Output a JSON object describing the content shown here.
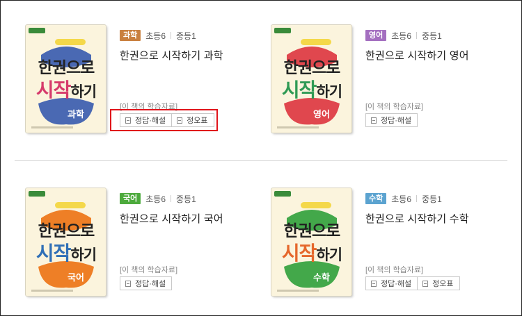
{
  "materials_label": "[이 책의 학습자료]",
  "books": [
    {
      "subject_tag": "과학",
      "tag_color": "#c9803f",
      "grade_elem": "초등6",
      "grade_mid": "중등1",
      "title": "한권으로 시작하기 과학",
      "cover": {
        "line1": "한권으로",
        "line2_a": "시작",
        "line2_b": "하기",
        "subject": "과학",
        "blob_color": "#4a69b3",
        "accent_color": "#d63a6b"
      },
      "buttons": [
        {
          "label": "정답·해설",
          "icon": "document-icon"
        },
        {
          "label": "정오표",
          "icon": "clipboard-icon"
        }
      ]
    },
    {
      "subject_tag": "영어",
      "tag_color": "#a46fc0",
      "grade_elem": "초등6",
      "grade_mid": "중등1",
      "title": "한권으로 시작하기 영어",
      "cover": {
        "line1": "한권으로",
        "line2_a": "시작",
        "line2_b": "하기",
        "subject": "영어",
        "blob_color": "#e0474e",
        "accent_color": "#2f9a54"
      },
      "buttons": [
        {
          "label": "정답·해설",
          "icon": "document-icon"
        }
      ]
    },
    {
      "subject_tag": "국어",
      "tag_color": "#4caa3c",
      "grade_elem": "초등6",
      "grade_mid": "중등1",
      "title": "한권으로 시작하기 국어",
      "cover": {
        "line1": "한권으로",
        "line2_a": "시작",
        "line2_b": "하기",
        "subject": "국어",
        "blob_color": "#ee7f26",
        "accent_color": "#2f6fb6"
      },
      "buttons": [
        {
          "label": "정답·해설",
          "icon": "document-icon"
        }
      ]
    },
    {
      "subject_tag": "수학",
      "tag_color": "#5ba3d0",
      "grade_elem": "초등6",
      "grade_mid": "중등1",
      "title": "한권으로 시작하기 수학",
      "cover": {
        "line1": "한권으로",
        "line2_a": "시작",
        "line2_b": "하기",
        "subject": "수학",
        "blob_color": "#43a84a",
        "accent_color": "#e5672b"
      },
      "buttons": [
        {
          "label": "정답·해설",
          "icon": "document-icon"
        },
        {
          "label": "정오표",
          "icon": "clipboard-icon"
        }
      ]
    }
  ]
}
